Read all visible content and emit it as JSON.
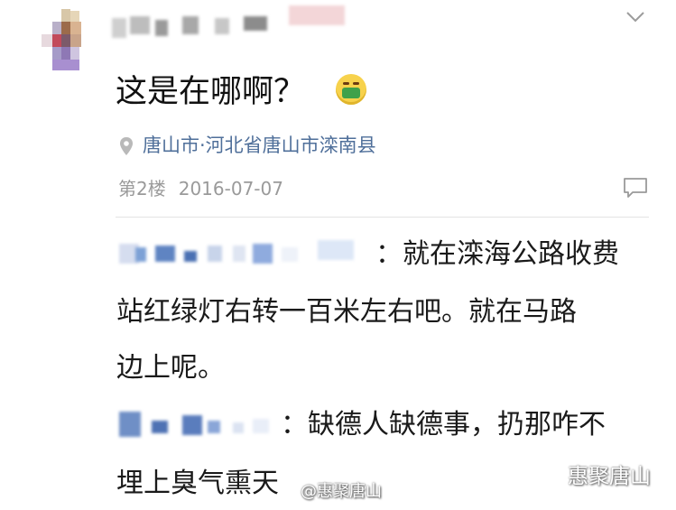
{
  "post": {
    "text": "这是在哪啊？",
    "emoji": "sick-face-emoji",
    "location": "唐山市·河北省唐山市滦南县",
    "floor": "第2楼",
    "date": "2016-07-07"
  },
  "replies": [
    {
      "lines": [
        "：就在滦海公路收费",
        "站红绿灯右转一百米左右吧。就在马路",
        "边上呢。"
      ]
    },
    {
      "lines": [
        "：缺德人缺德事，扔那咋不",
        "埋上臭气熏天"
      ]
    }
  ],
  "watermarks": {
    "weibo": "@惠聚唐山",
    "wechat": "惠聚唐山"
  },
  "icons": [
    "location-pin-icon",
    "chevron-down-icon",
    "comment-icon",
    "wechat-icon",
    "weibo-icon"
  ],
  "colors": {
    "location_text": "#4f6f9a",
    "meta_text": "#9a9a9a",
    "divider": "#e3e3e3"
  }
}
